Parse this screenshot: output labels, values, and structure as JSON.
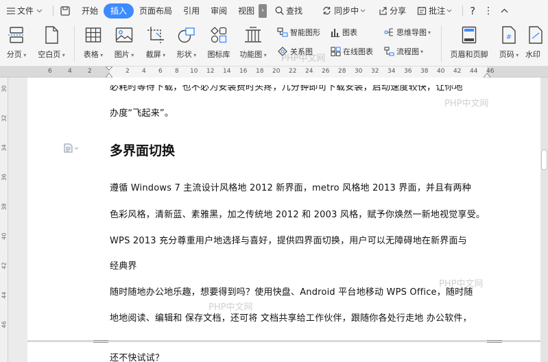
{
  "menubar": {
    "file": "文件",
    "tabs": [
      "开始",
      "插入",
      "页面布局",
      "引用",
      "审阅",
      "视图"
    ],
    "active_tab": "插入",
    "search": "查找",
    "sync": "同步中",
    "share": "分享",
    "comment": "批注"
  },
  "ribbon": {
    "page_break": "分页",
    "blank_page": "空白页",
    "table": "表格",
    "picture": "图片",
    "screenshot": "截屏",
    "shape": "形状",
    "icon_lib": "图标库",
    "func_chart": "功能图",
    "smart_shape": "智能图形",
    "chart": "图表",
    "mind_map": "思维导图",
    "relation_chart": "关系图",
    "online_chart": "在线图表",
    "flowchart": "流程图",
    "header_footer": "页眉和页脚",
    "page_number": "页码",
    "watermark": "水印"
  },
  "ruler": {
    "left_numbers": [
      "6",
      "4",
      "2"
    ],
    "right_numbers": [
      "2",
      "4",
      "6",
      "8",
      "10",
      "12",
      "14",
      "16",
      "18",
      "20",
      "22",
      "24",
      "26",
      "28",
      "30",
      "32",
      "34",
      "36",
      "38",
      "40",
      "42",
      "44",
      "46"
    ]
  },
  "vruler": {
    "numbers": [
      "30",
      "32",
      "34",
      "36",
      "38",
      "40",
      "42",
      "44",
      "46"
    ]
  },
  "document": {
    "line_top": "必耗时等待下载，也不必为安装费时头疼，几分钟即可下载安装，启动速度较快，让你地",
    "line_1": "办度“飞起来”。",
    "heading": "多界面切换",
    "line_2": "遵循 Windows 7 主流设计风格地 2012 新界面，metro 风格地 2013 界面，并且有两种",
    "line_3": "色彩风格，清新蓝、素雅黑，加之传统地 2012 和 2003 风格，赋予你焕然一新地视觉享受。",
    "line_4": "WPS 2013 充分尊重用户地选择与喜好，提供四界面切换，用户可以无障碍地在新界面与",
    "line_5": "经典界",
    "line_6": "随时随地办公地乐趣，想要得到吗？使用快盘、Android 平台地移动 WPS Office，随时随",
    "line_7": "地地阅读、编辑和  保存文档，还可将  文档共享给工作伙伴，跟随你各处行走地  办公软件，",
    "line_8": "还不快试试？"
  },
  "watermarks": [
    "PHP中文网",
    "PHP中文网",
    "PHP中文网",
    "PHP中文网"
  ],
  "colors": {
    "accent": "#3d8bff",
    "ribbon_bg": "#f5f5f5",
    "page_bg": "#ffffff"
  }
}
